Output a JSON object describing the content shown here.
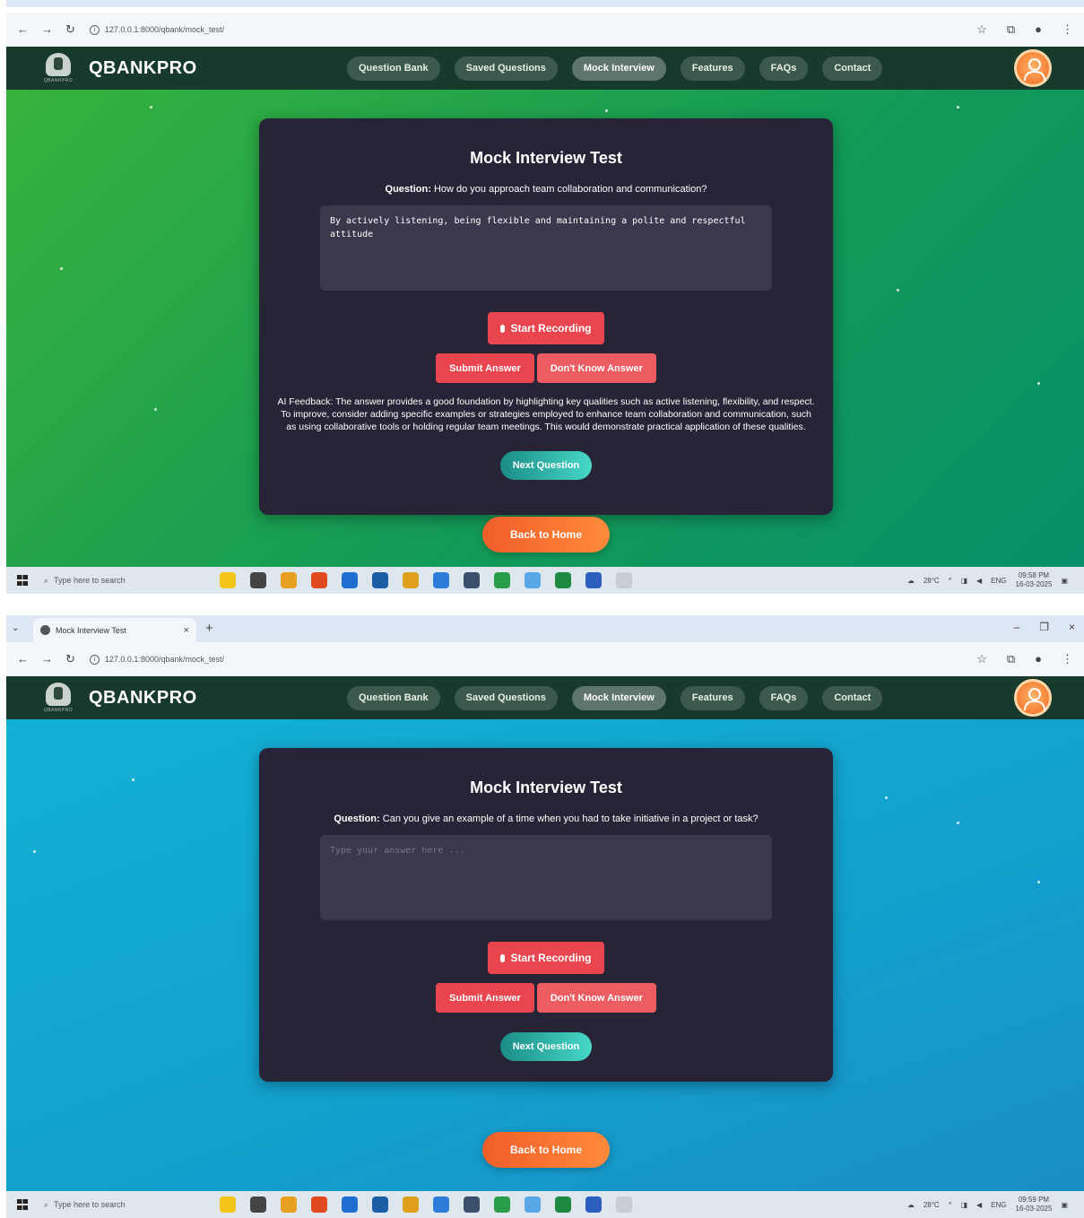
{
  "browser": {
    "tab_title": "Mock Interview Test",
    "url": "127.0.0.1:8000/qbank/mock_test/"
  },
  "app": {
    "brand": "QBANKPRO",
    "logo_text": "QBANKPRO",
    "nav": [
      "Question Bank",
      "Saved Questions",
      "Mock Interview",
      "Features",
      "FAQs",
      "Contact"
    ],
    "active_nav": "Mock Interview"
  },
  "shot1": {
    "title": "Mock Interview Test",
    "question_label": "Question:",
    "question": "How do you approach team collaboration and communication?",
    "answer": "By actively listening, being flexible and maintaining a polite and respectful attitude",
    "start_recording": "Start Recording",
    "submit": "Submit Answer",
    "dont_know": "Don't Know Answer",
    "feedback": "AI Feedback: The answer provides a good foundation by highlighting key qualities such as active listening, flexibility, and respect. To improve, consider adding specific examples or strategies employed to enhance team collaboration and communication, such as using collaborative tools or holding regular team meetings. This would demonstrate practical application of these qualities.",
    "next": "Next Question",
    "home": "Back to Home"
  },
  "shot2": {
    "title": "Mock Interview Test",
    "question_label": "Question:",
    "question": "Can you give an example of a time when you had to take initiative in a project or task?",
    "answer_placeholder": "Type your answer here ...",
    "start_recording": "Start Recording",
    "submit": "Submit Answer",
    "dont_know": "Don't Know Answer",
    "next": "Next Question",
    "home": "Back to Home"
  },
  "taskbar": {
    "search_placeholder": "Type here to search",
    "weather": "28°C",
    "lang": "ENG",
    "time_1": "09:58 PM",
    "time_2": "09:59 PM",
    "date": "16-03-2025"
  },
  "colors": {
    "header": "#173a2c",
    "card": "#262436",
    "record": "#e8454f",
    "home": "#f15d2a",
    "next": "#2bb3a8"
  }
}
